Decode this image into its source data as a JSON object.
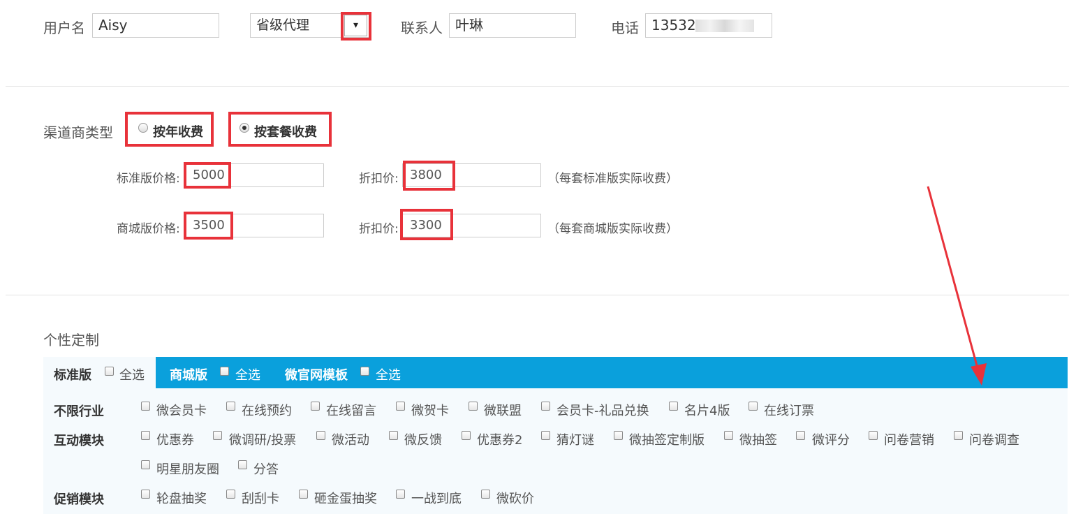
{
  "top": {
    "username_label": "用户名",
    "username_value": "Aisy",
    "level_select_value": "省级代理",
    "dropdown_arrow": "▾",
    "contact_label": "联系人",
    "contact_value": "叶琳",
    "phone_label": "电话",
    "phone_value": "13532"
  },
  "channel": {
    "type_label": "渠道商类型",
    "options": [
      "按年收费",
      "按套餐收费"
    ],
    "selected": "按套餐收费"
  },
  "pricing": {
    "rows": [
      {
        "label": "标准版价格:",
        "price": "5000",
        "discount_label": "折扣价:",
        "discount": "3800",
        "note": "（每套标准版实际收费）"
      },
      {
        "label": "商城版价格:",
        "price": "3500",
        "discount_label": "折扣价:",
        "discount": "3300",
        "note": "（每套商城版实际收费）"
      }
    ]
  },
  "custom": {
    "title": "个性定制",
    "tabs": [
      {
        "label": "标准版",
        "select_all": "全选"
      },
      {
        "label": "商城版",
        "select_all": "全选"
      },
      {
        "label": "微官网模板",
        "select_all": "全选"
      }
    ],
    "groups": [
      {
        "title": "不限行业",
        "items": [
          "微会员卡",
          "在线预约",
          "在线留言",
          "微贺卡",
          "微联盟",
          "会员卡-礼品兑换",
          "名片4版",
          "在线订票"
        ]
      },
      {
        "title": "互动模块",
        "items": [
          "优惠券",
          "微调研/投票",
          "微活动",
          "微反馈",
          "优惠券2",
          "猜灯谜",
          "微抽签定制版",
          "微抽签",
          "微评分",
          "问卷营销",
          "问卷调查",
          "明星朋友圈",
          "分答"
        ]
      },
      {
        "title": "促销模块",
        "items": [
          "轮盘抽奖",
          "刮刮卡",
          "砸金蛋抽奖",
          "一战到底",
          "微砍价"
        ]
      }
    ]
  },
  "colors": {
    "highlight": "#e8323a",
    "tab_bar": "#0aa0dc",
    "panel_bg": "#f5fafd"
  }
}
